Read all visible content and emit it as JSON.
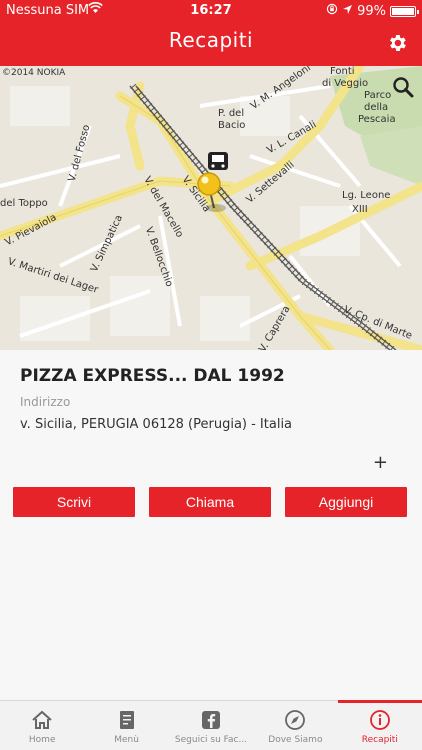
{
  "status": {
    "carrier": "Nessuna SIM",
    "time": "16:27",
    "battery_text": "99%",
    "battery_level": 0.99
  },
  "nav": {
    "title": "Recapiti",
    "settings_icon": "gear-icon"
  },
  "map": {
    "copyright": "©2014 NOKIA",
    "labels": {
      "fonti": "Fonti",
      "di_veggio": "di Veggio",
      "parco": "Parco",
      "della": "della",
      "pescaia": "Pescaia",
      "p_del": "P. del",
      "bacio": "Bacio",
      "v_m_angeloni": "V. M. Angeloni",
      "v_l_canali": "V. L. Canali",
      "v_del_fosso": "V. del Fosso",
      "v_settevalli": "V. Settevalli",
      "lg_leone": "Lg. Leone",
      "xiii": "XIII",
      "del_toppo": "del Toppo",
      "v_del_macello": "V. del Macello",
      "v_sicilia": "V. Sicilia",
      "v_pievaiola": "V. Pievaiola",
      "v_simpatica": "V. Simpatica",
      "v_bellocchio": "V. Bellocchio",
      "v_martiri": "V. Martiri dei Lager",
      "v_caprera": "V. Caprera",
      "v_cp_di_marte": "V. Cp. di Marte"
    }
  },
  "contact": {
    "name": "PIZZA EXPRESS... DAL 1992",
    "address_label": "Indirizzo",
    "address": "v. Sicilia, PERUGIA 06128 (Perugia) - Italia",
    "plus": "+"
  },
  "actions": {
    "write": "Scrivi",
    "call": "Chiama",
    "add": "Aggiungi"
  },
  "tabs": [
    {
      "label": "Home",
      "icon": "home-icon"
    },
    {
      "label": "Menù",
      "icon": "menu-book-icon"
    },
    {
      "label": "Seguici su Fac...",
      "icon": "facebook-icon"
    },
    {
      "label": "Dove Siamo",
      "icon": "compass-icon"
    },
    {
      "label": "Recapiti",
      "icon": "info-icon"
    }
  ],
  "colors": {
    "accent": "#e52329",
    "map_bg": "#eae6dc",
    "road_yellow": "#f3e38a"
  }
}
